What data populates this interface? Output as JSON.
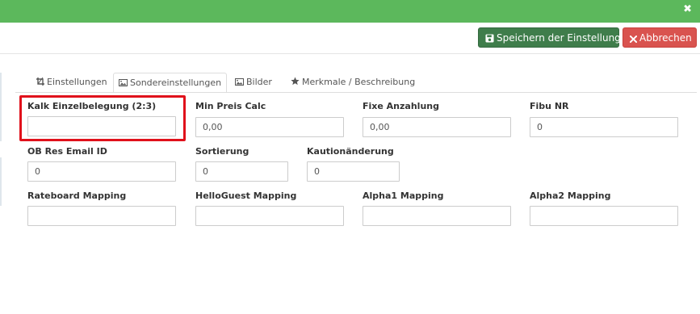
{
  "header": {
    "close_glyph": "✖"
  },
  "toolbar": {
    "save_label": "Speichern der Einstellung",
    "cancel_label": "Abbrechen",
    "save_color": "#3f7d4b",
    "cancel_color": "#d9534f"
  },
  "tabs": [
    {
      "label": "Einstellungen",
      "icon": "crop-icon",
      "active": false
    },
    {
      "label": "Sondereinstellungen",
      "icon": "image-icon",
      "active": true
    },
    {
      "label": "Bilder",
      "icon": "image-icon",
      "active": false
    },
    {
      "label": "Merkmale / Beschreibung",
      "icon": "star-icon",
      "active": false
    }
  ],
  "fields": {
    "kalk_einzelbelegung": {
      "label": "Kalk Einzelbelegung (2:3)",
      "value": ""
    },
    "min_preis_calc": {
      "label": "Min Preis Calc",
      "value": "0,00"
    },
    "fixe_anzahlung": {
      "label": "Fixe Anzahlung",
      "value": "0,00"
    },
    "fibu_nr": {
      "label": "Fibu NR",
      "value": "0"
    },
    "ob_res_email_id": {
      "label": "OB Res Email ID",
      "value": "0"
    },
    "sortierung": {
      "label": "Sortierung",
      "value": "0"
    },
    "kautionaenderung": {
      "label": "Kautionänderung",
      "value": "0"
    },
    "rateboard_mapping": {
      "label": "Rateboard Mapping",
      "value": ""
    },
    "helloguest_mapping": {
      "label": "HelloGuest Mapping",
      "value": ""
    },
    "alpha1_mapping": {
      "label": "Alpha1 Mapping",
      "value": ""
    },
    "alpha2_mapping": {
      "label": "Alpha2 Mapping",
      "value": ""
    }
  },
  "colors": {
    "header_green": "#5cb85c",
    "highlight_red": "#e0111b"
  }
}
